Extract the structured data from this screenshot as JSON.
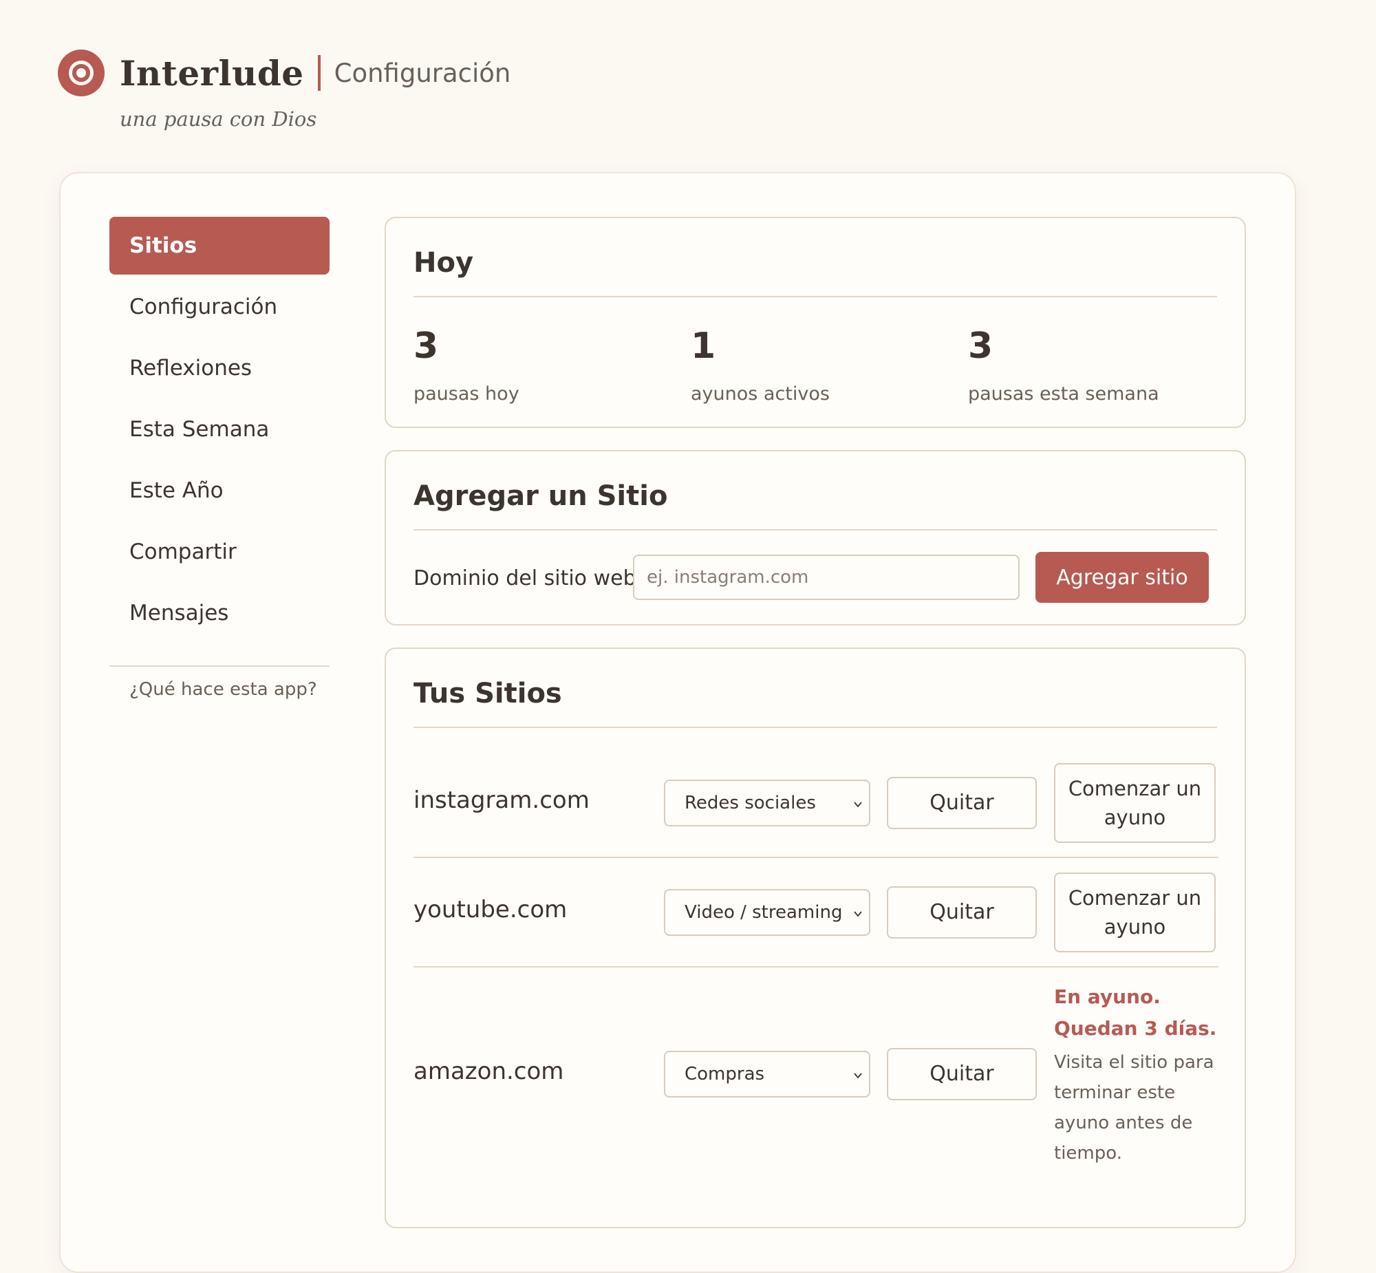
{
  "app": {
    "name": "Interlude",
    "page": "Configuración",
    "tagline": "una pausa con Dios"
  },
  "colors": {
    "accent": "#b65a52",
    "background": "#fcf8f2",
    "text": "#3d3430",
    "muted": "#6b5f57"
  },
  "sidebar": {
    "items": [
      {
        "label": "Sitios",
        "active": true
      },
      {
        "label": "Configuración"
      },
      {
        "label": "Reflexiones"
      },
      {
        "label": "Esta Semana"
      },
      {
        "label": "Este Año"
      },
      {
        "label": "Compartir"
      },
      {
        "label": "Mensajes"
      }
    ],
    "help": "¿Qué hace esta app?"
  },
  "today": {
    "title": "Hoy",
    "stats": [
      {
        "value": "3",
        "label": "pausas hoy"
      },
      {
        "value": "1",
        "label": "ayunos activos"
      },
      {
        "value": "3",
        "label": "pausas esta semana"
      }
    ]
  },
  "add_site": {
    "title": "Agregar un Sitio",
    "field_label": "Dominio del sitio web",
    "placeholder": "ej. instagram.com",
    "button": "Agregar sitio"
  },
  "sites": {
    "title": "Tus Sitios",
    "remove_label": "Quitar",
    "fast_label": "Comenzar un ayuno",
    "rows": [
      {
        "domain": "instagram.com",
        "category": "Redes sociales"
      },
      {
        "domain": "youtube.com",
        "category": "Video / streaming"
      },
      {
        "domain": "amazon.com",
        "category": "Compras",
        "fast_status": "En ayuno. Quedan 3 días.",
        "fast_note": "Visita el sitio para terminar este ayuno antes de tiempo."
      }
    ]
  }
}
